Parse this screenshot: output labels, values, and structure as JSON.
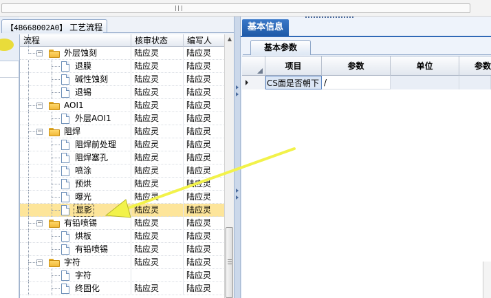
{
  "document": {
    "code": "【4B668002A0】",
    "title": "工艺流程"
  },
  "tree": {
    "columns": {
      "flow": "流程",
      "review": "核审状态",
      "author": "编写人"
    },
    "rows": [
      {
        "label": "外层蚀刻",
        "kind": "folder",
        "level": 0,
        "expander": "−",
        "review": "陆应灵",
        "author": "陆应灵",
        "selected": false
      },
      {
        "label": "退膜",
        "kind": "page",
        "level": 1,
        "review": "陆应灵",
        "author": "陆应灵",
        "selected": false
      },
      {
        "label": "碱性蚀刻",
        "kind": "page",
        "level": 1,
        "review": "陆应灵",
        "author": "陆应灵",
        "selected": false
      },
      {
        "label": "退锡",
        "kind": "page",
        "level": 1,
        "review": "陆应灵",
        "author": "陆应灵",
        "selected": false
      },
      {
        "label": "AOI1",
        "kind": "folder",
        "level": 0,
        "expander": "−",
        "review": "陆应灵",
        "author": "陆应灵",
        "selected": false
      },
      {
        "label": "外层AOI1",
        "kind": "page",
        "level": 1,
        "review": "陆应灵",
        "author": "陆应灵",
        "selected": false
      },
      {
        "label": "阻焊",
        "kind": "folder",
        "level": 0,
        "expander": "−",
        "review": "陆应灵",
        "author": "陆应灵",
        "selected": false
      },
      {
        "label": "阻焊前处理",
        "kind": "page",
        "level": 1,
        "review": "陆应灵",
        "author": "陆应灵",
        "selected": false
      },
      {
        "label": "阻焊塞孔",
        "kind": "page",
        "level": 1,
        "review": "陆应灵",
        "author": "陆应灵",
        "selected": false
      },
      {
        "label": "喷涂",
        "kind": "page",
        "level": 1,
        "review": "陆应灵",
        "author": "陆应灵",
        "selected": false
      },
      {
        "label": "预烘",
        "kind": "page",
        "level": 1,
        "review": "陆应灵",
        "author": "陆应灵",
        "selected": false
      },
      {
        "label": "曝光",
        "kind": "page",
        "level": 1,
        "review": "陆应灵",
        "author": "陆应灵",
        "selected": false
      },
      {
        "label": "显影",
        "kind": "page",
        "level": 1,
        "review": "陆应灵",
        "author": "陆应灵",
        "selected": true
      },
      {
        "label": "有铅喷锡",
        "kind": "folder",
        "level": 0,
        "expander": "−",
        "review": "陆应灵",
        "author": "陆应灵",
        "selected": false
      },
      {
        "label": "烘板",
        "kind": "page",
        "level": 1,
        "review": "陆应灵",
        "author": "陆应灵",
        "selected": false
      },
      {
        "label": "有铅喷锡",
        "kind": "page",
        "level": 1,
        "review": "陆应灵",
        "author": "陆应灵",
        "selected": false
      },
      {
        "label": "字符",
        "kind": "folder",
        "level": 0,
        "expander": "−",
        "review": "陆应灵",
        "author": "陆应灵",
        "selected": false
      },
      {
        "label": "字符",
        "kind": "page",
        "level": 1,
        "review": "",
        "author": "陆应灵",
        "selected": false
      },
      {
        "label": "终固化",
        "kind": "page",
        "level": 1,
        "review": "陆应灵",
        "author": "陆应灵",
        "selected": false
      }
    ]
  },
  "panel": {
    "tab": "基本信息",
    "subtab": "基本参数",
    "columns": {
      "item": "项目",
      "param": "参数",
      "unit": "单位",
      "param2": "参数"
    },
    "rows": [
      {
        "item": "CS面是否朝下",
        "param": "/",
        "unit": ""
      }
    ]
  },
  "annotation": {
    "color": "#f2f24a"
  }
}
